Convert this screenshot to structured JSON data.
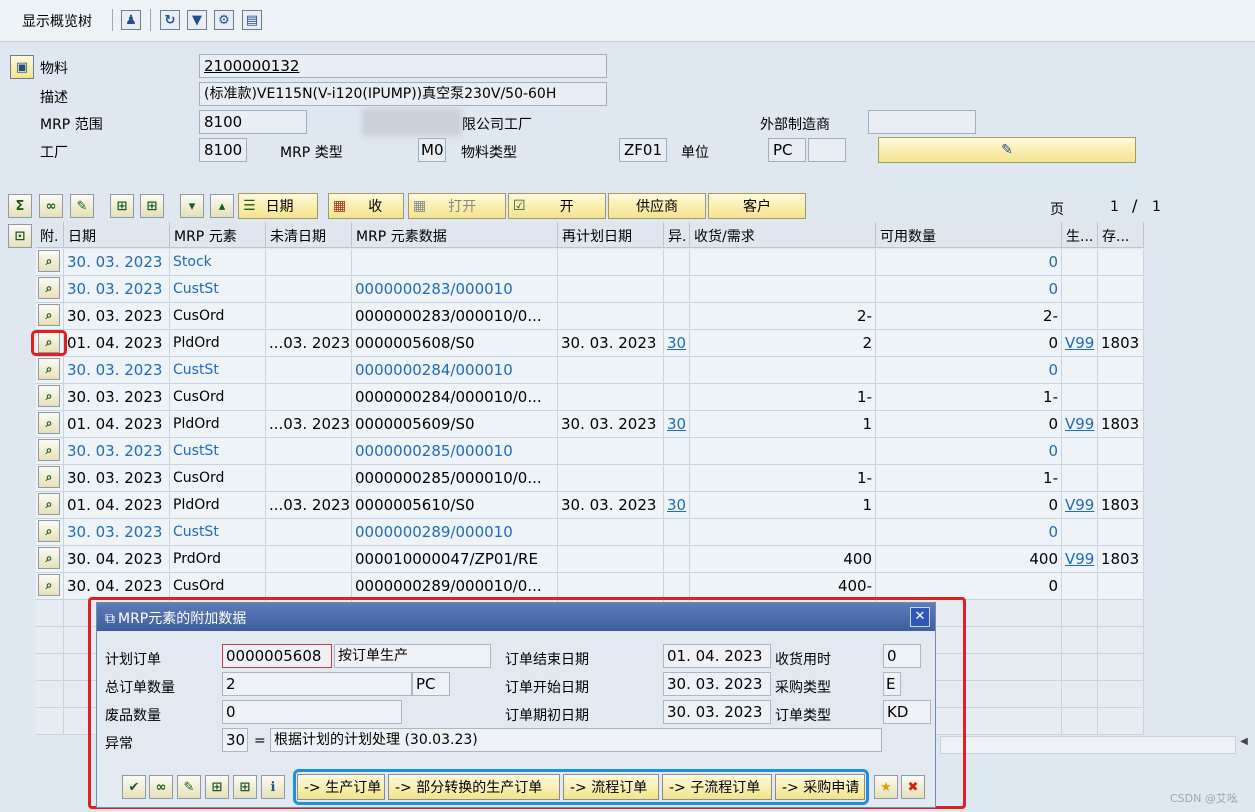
{
  "toolbar": {
    "show_tree_label": "显示概览树"
  },
  "header": {
    "material_label": "物料",
    "material_value": "2100000132",
    "desc_label": "描述",
    "desc_value": "(标准款)VE115N(V-i120(IPUMP))真空泵230V/50-60H",
    "mrp_area_label": "MRP 范围",
    "mrp_area_value": "8100",
    "mrp_area_desc": "限公司工厂",
    "ext_mfr_label": "外部制造商",
    "plant_label": "工厂",
    "plant_value": "8100",
    "mrp_type_label": "MRP 类型",
    "mrp_type_value": "M0",
    "mat_type_label": "物料类型",
    "mat_type_value": "ZF01",
    "unit_label": "单位",
    "unit_value": "PC"
  },
  "actions": {
    "date_label": "日期",
    "receipt_label": "收",
    "open_label": "打开",
    "open2_label": "开",
    "vendor_label": "供应商",
    "customer_label": "客户",
    "page_label": "页",
    "page_current": "1",
    "page_sep": "/",
    "page_total": "1"
  },
  "columns": [
    "附.",
    "日期",
    "MRP 元素",
    "未清日期",
    "MRP 元素数据",
    "再计划日期",
    "异.",
    "收货/需求",
    "可用数量",
    "生...",
    "存..."
  ],
  "rows": [
    {
      "date": "30. 03. 2023",
      "elem": "Stock",
      "open": "",
      "data": "",
      "resched": "",
      "exc": "",
      "qty": "",
      "avail": "0",
      "prod": "",
      "stor": "",
      "hl": true
    },
    {
      "date": "30. 03. 2023",
      "elem": "CustSt",
      "open": "",
      "data": "0000000283/000010",
      "resched": "",
      "exc": "",
      "qty": "",
      "avail": "0",
      "prod": "",
      "stor": "",
      "hl": true
    },
    {
      "date": "30. 03. 2023",
      "elem": "CusOrd",
      "open": "",
      "data": "0000000283/000010/0...",
      "resched": "",
      "exc": "",
      "qty": "2-",
      "avail": "2-",
      "prod": "",
      "stor": "",
      "hl": false
    },
    {
      "date": "01. 04. 2023",
      "elem": "PldOrd",
      "open": "...03. 2023",
      "data": "0000005608/S0",
      "resched": "30. 03. 2023",
      "exc": "30",
      "qty": "2",
      "avail": "0",
      "prod": "V99",
      "stor": "1803",
      "hl": false
    },
    {
      "date": "30. 03. 2023",
      "elem": "CustSt",
      "open": "",
      "data": "0000000284/000010",
      "resched": "",
      "exc": "",
      "qty": "",
      "avail": "0",
      "prod": "",
      "stor": "",
      "hl": true
    },
    {
      "date": "30. 03. 2023",
      "elem": "CusOrd",
      "open": "",
      "data": "0000000284/000010/0...",
      "resched": "",
      "exc": "",
      "qty": "1-",
      "avail": "1-",
      "prod": "",
      "stor": "",
      "hl": false
    },
    {
      "date": "01. 04. 2023",
      "elem": "PldOrd",
      "open": "...03. 2023",
      "data": "0000005609/S0",
      "resched": "30. 03. 2023",
      "exc": "30",
      "qty": "1",
      "avail": "0",
      "prod": "V99",
      "stor": "1803",
      "hl": false
    },
    {
      "date": "30. 03. 2023",
      "elem": "CustSt",
      "open": "",
      "data": "0000000285/000010",
      "resched": "",
      "exc": "",
      "qty": "",
      "avail": "0",
      "prod": "",
      "stor": "",
      "hl": true
    },
    {
      "date": "30. 03. 2023",
      "elem": "CusOrd",
      "open": "",
      "data": "0000000285/000010/0...",
      "resched": "",
      "exc": "",
      "qty": "1-",
      "avail": "1-",
      "prod": "",
      "stor": "",
      "hl": false
    },
    {
      "date": "01. 04. 2023",
      "elem": "PldOrd",
      "open": "...03. 2023",
      "data": "0000005610/S0",
      "resched": "30. 03. 2023",
      "exc": "30",
      "qty": "1",
      "avail": "0",
      "prod": "V99",
      "stor": "1803",
      "hl": false
    },
    {
      "date": "30. 03. 2023",
      "elem": "CustSt",
      "open": "",
      "data": "0000000289/000010",
      "resched": "",
      "exc": "",
      "qty": "",
      "avail": "0",
      "prod": "",
      "stor": "",
      "hl": true
    },
    {
      "date": "30. 04. 2023",
      "elem": "PrdOrd",
      "open": "",
      "data": "000010000047/ZP01/RE",
      "resched": "",
      "exc": "",
      "qty": "400",
      "avail": "400",
      "prod": "V99",
      "stor": "1803",
      "hl": false
    },
    {
      "date": "30. 04. 2023",
      "elem": "CusOrd",
      "open": "",
      "data": "0000000289/000010/0...",
      "resched": "",
      "exc": "",
      "qty": "400-",
      "avail": "0",
      "prod": "",
      "stor": "",
      "hl": false
    }
  ],
  "dialog": {
    "title": "MRP元素的附加数据",
    "planned_order_label": "计划订单",
    "planned_order_value": "0000005608",
    "planned_order_desc": "按订单生产",
    "total_qty_label": "总订单数量",
    "total_qty_value": "2",
    "total_qty_unit": "PC",
    "scrap_label": "废品数量",
    "scrap_value": "0",
    "exception_label": "异常",
    "exception_code": "30",
    "exception_eq": "=",
    "exception_text": "根据计划的计划处理 (30.03.23)",
    "end_date_label": "订单结束日期",
    "end_date_value": "01. 04. 2023",
    "start_date_label": "订单开始日期",
    "start_date_value": "30. 03. 2023",
    "open_date_label": "订单期初日期",
    "open_date_value": "30. 03. 2023",
    "gr_time_label": "收货用时",
    "gr_time_value": "0",
    "proc_type_label": "采购类型",
    "proc_type_value": "E",
    "order_type_label": "订单类型",
    "order_type_value": "KD",
    "btn_prod_order": "-> 生产订单",
    "btn_partial": "-> 部分转换的生产订单",
    "btn_process": "-> 流程订单",
    "btn_subprocess": "-> 子流程订单",
    "btn_purreq": "-> 采购申请"
  },
  "watermark": "CSDN @艾吆",
  "colors": {
    "highlight_red": "#e02020",
    "highlight_blue": "#1e90e0",
    "link_blue": "#1f6bb4"
  }
}
